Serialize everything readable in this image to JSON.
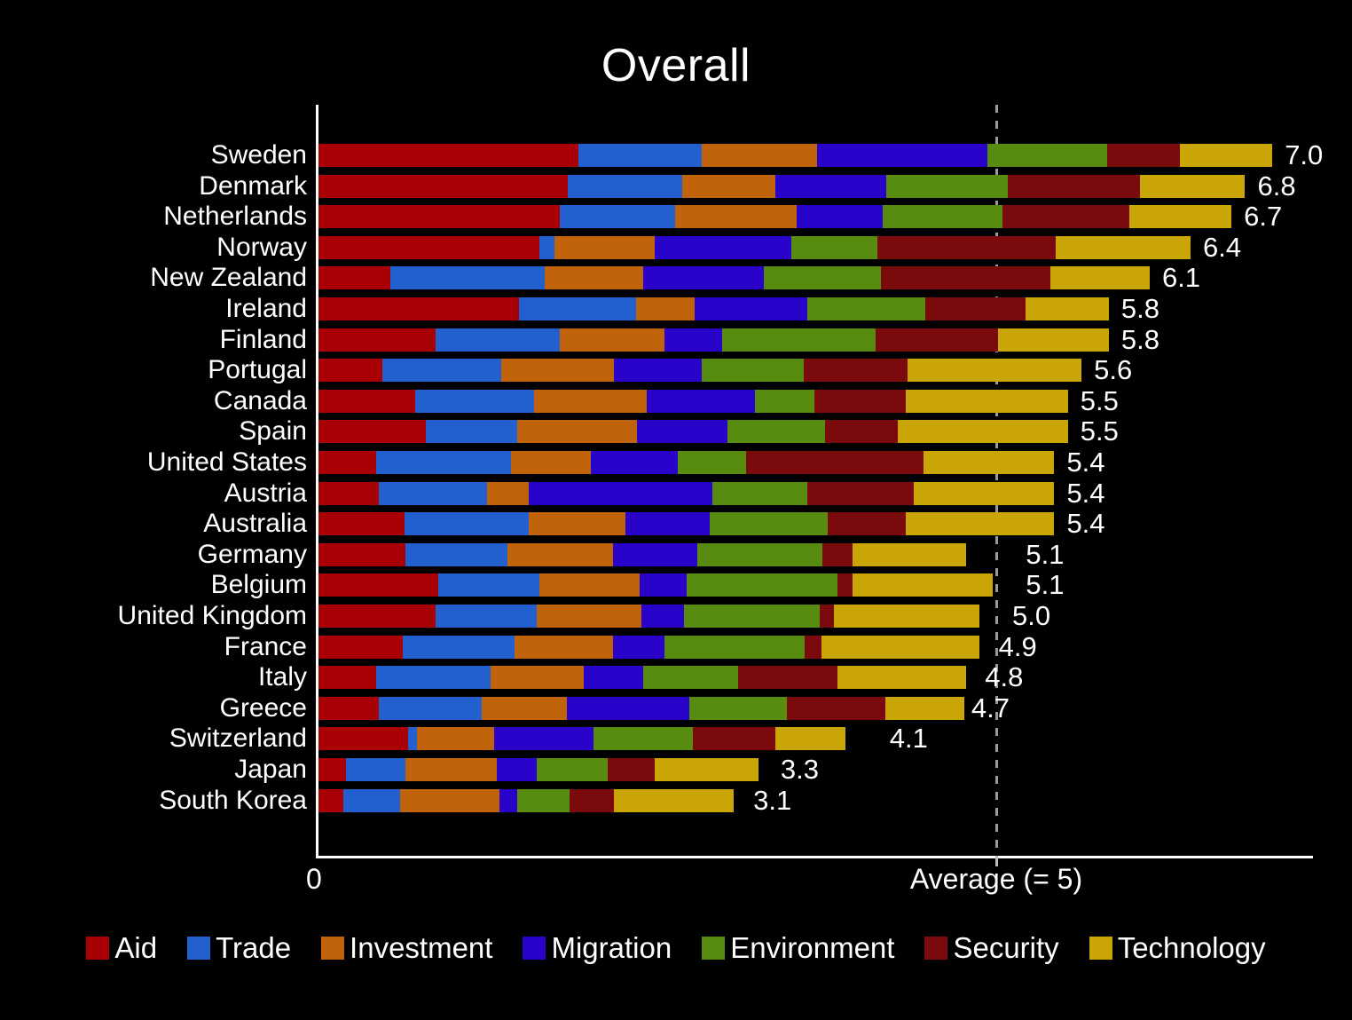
{
  "chart_data": {
    "type": "bar",
    "subtype": "horizontal-stacked",
    "title": "Overall",
    "xlabel": "",
    "ylabel": "",
    "xlim": [
      0,
      7.3
    ],
    "grid": false,
    "legend_position": "bottom",
    "axis_ticks": [
      {
        "label": "0",
        "value": 0
      },
      {
        "label": "Average (= 5)",
        "value": 5
      }
    ],
    "reference_line": {
      "label": "Average (= 5)",
      "value": 5,
      "style": "dashed",
      "color": "#9a9a9a"
    },
    "series": [
      {
        "name": "Aid",
        "color": "#A80005"
      },
      {
        "name": "Trade",
        "color": "#2160CE"
      },
      {
        "name": "Investment",
        "color": "#C1630A"
      },
      {
        "name": "Migration",
        "color": "#2A03CA"
      },
      {
        "name": "Environment",
        "color": "#588C11"
      },
      {
        "name": "Security",
        "color": "#7B0A0D"
      },
      {
        "name": "Technology",
        "color": "#C9A505"
      }
    ],
    "categories": [
      "Sweden",
      "Denmark",
      "Netherlands",
      "Norway",
      "New Zealand",
      "Ireland",
      "Finland",
      "Portugal",
      "Canada",
      "Spain",
      "United States",
      "Austria",
      "Australia",
      "Germany",
      "Belgium",
      "United Kingdom",
      "France",
      "Italy",
      "Greece",
      "Switzerland",
      "Japan",
      "South Korea"
    ],
    "totals": [
      7.0,
      6.8,
      6.7,
      6.4,
      6.1,
      5.8,
      5.8,
      5.6,
      5.5,
      5.5,
      5.4,
      5.4,
      5.4,
      5.1,
      5.1,
      5.0,
      4.9,
      4.8,
      4.7,
      4.1,
      3.3,
      3.1
    ],
    "total_labels": [
      "7.0",
      "6.8",
      "6.7",
      "6.4",
      "6.1",
      "5.8",
      "5.8",
      "5.6",
      "5.5",
      "5.5",
      "5.4",
      "5.4",
      "5.4",
      "5.1",
      "5.1",
      "5.0",
      "4.9",
      "4.8",
      "4.7",
      "4.1",
      "3.3",
      "3.1"
    ],
    "rows": [
      {
        "category": "Sweden",
        "total": 7.0,
        "total_label": "7.0",
        "values": [
          1.91,
          0.9,
          0.85,
          1.25,
          0.88,
          0.53,
          0.68
        ]
      },
      {
        "category": "Denmark",
        "total": 6.8,
        "total_label": "6.8",
        "values": [
          1.83,
          0.84,
          0.68,
          0.82,
          0.89,
          0.97,
          0.77
        ]
      },
      {
        "category": "Netherlands",
        "total": 6.7,
        "total_label": "6.7",
        "values": [
          1.77,
          0.85,
          0.89,
          0.63,
          0.88,
          0.93,
          0.75
        ]
      },
      {
        "category": "Norway",
        "total": 6.4,
        "total_label": "6.4",
        "values": [
          1.62,
          0.11,
          0.74,
          1.0,
          0.63,
          1.31,
          0.99
        ]
      },
      {
        "category": "New Zealand",
        "total": 6.1,
        "total_label": "6.1",
        "values": [
          0.53,
          1.13,
          0.72,
          0.89,
          0.86,
          1.24,
          0.73
        ]
      },
      {
        "category": "Ireland",
        "total": 5.8,
        "total_label": "5.8",
        "values": [
          1.47,
          0.86,
          0.43,
          0.83,
          0.86,
          0.74,
          0.61
        ]
      },
      {
        "category": "Finland",
        "total": 5.8,
        "total_label": "5.8",
        "values": [
          0.86,
          0.91,
          0.77,
          0.42,
          1.13,
          0.9,
          0.81
        ]
      },
      {
        "category": "Portugal",
        "total": 5.6,
        "total_label": "5.6",
        "values": [
          0.47,
          0.87,
          0.83,
          0.64,
          0.75,
          0.76,
          1.28
        ]
      },
      {
        "category": "Canada",
        "total": 5.5,
        "total_label": "5.5",
        "values": [
          0.71,
          0.87,
          0.83,
          0.79,
          0.44,
          0.67,
          1.19
        ]
      },
      {
        "category": "Spain",
        "total": 5.5,
        "total_label": "5.5",
        "values": [
          0.79,
          0.67,
          0.88,
          0.66,
          0.72,
          0.53,
          1.25
        ]
      },
      {
        "category": "United States",
        "total": 5.4,
        "total_label": "5.4",
        "values": [
          0.42,
          0.99,
          0.59,
          0.64,
          0.5,
          1.3,
          0.96
        ]
      },
      {
        "category": "Austria",
        "total": 5.4,
        "total_label": "5.4",
        "values": [
          0.44,
          0.8,
          0.3,
          1.35,
          0.7,
          0.78,
          1.03
        ]
      },
      {
        "category": "Australia",
        "total": 5.4,
        "total_label": "5.4",
        "values": [
          0.63,
          0.91,
          0.71,
          0.62,
          0.87,
          0.57,
          1.09
        ]
      },
      {
        "category": "Germany",
        "total": 5.1,
        "total_label": "5.1",
        "values": [
          0.64,
          0.75,
          0.77,
          0.62,
          0.92,
          0.22,
          0.83
        ]
      },
      {
        "category": "Belgium",
        "total": 5.1,
        "total_label": "5.1",
        "values": [
          0.88,
          0.74,
          0.74,
          0.34,
          1.11,
          0.11,
          1.03
        ]
      },
      {
        "category": "United Kingdom",
        "total": 5.0,
        "total_label": "5.0",
        "values": [
          0.86,
          0.74,
          0.77,
          0.31,
          1.0,
          0.1,
          1.07
        ]
      },
      {
        "category": "France",
        "total": 4.9,
        "total_label": "4.9",
        "values": [
          0.62,
          0.82,
          0.72,
          0.38,
          1.03,
          0.12,
          1.16
        ]
      },
      {
        "category": "Italy",
        "total": 4.8,
        "total_label": "4.8",
        "values": [
          0.42,
          0.84,
          0.69,
          0.43,
          0.7,
          0.73,
          0.94
        ]
      },
      {
        "category": "Greece",
        "total": 4.7,
        "total_label": "4.7",
        "values": [
          0.44,
          0.76,
          0.62,
          0.9,
          0.72,
          0.72,
          0.58
        ]
      },
      {
        "category": "Switzerland",
        "total": 4.1,
        "total_label": "4.1",
        "values": [
          0.66,
          0.06,
          0.57,
          0.73,
          0.73,
          0.6,
          0.52
        ]
      },
      {
        "category": "Japan",
        "total": 3.3,
        "total_label": "3.3",
        "values": [
          0.2,
          0.44,
          0.67,
          0.29,
          0.52,
          0.35,
          0.76
        ]
      },
      {
        "category": "South Korea",
        "total": 3.1,
        "total_label": "3.1",
        "values": [
          0.18,
          0.42,
          0.73,
          0.13,
          0.38,
          0.33,
          0.88
        ]
      }
    ]
  },
  "axis": {
    "zero_label": "0",
    "average_label": "Average (= 5)"
  },
  "legend": {
    "items": [
      {
        "label": "Aid",
        "color": "#A80005"
      },
      {
        "label": "Trade",
        "color": "#2160CE"
      },
      {
        "label": "Investment",
        "color": "#C1630A"
      },
      {
        "label": "Migration",
        "color": "#2A03CA"
      },
      {
        "label": "Environment",
        "color": "#588C11"
      },
      {
        "label": "Security",
        "color": "#7B0A0D"
      },
      {
        "label": "Technology",
        "color": "#C9A505"
      }
    ]
  }
}
